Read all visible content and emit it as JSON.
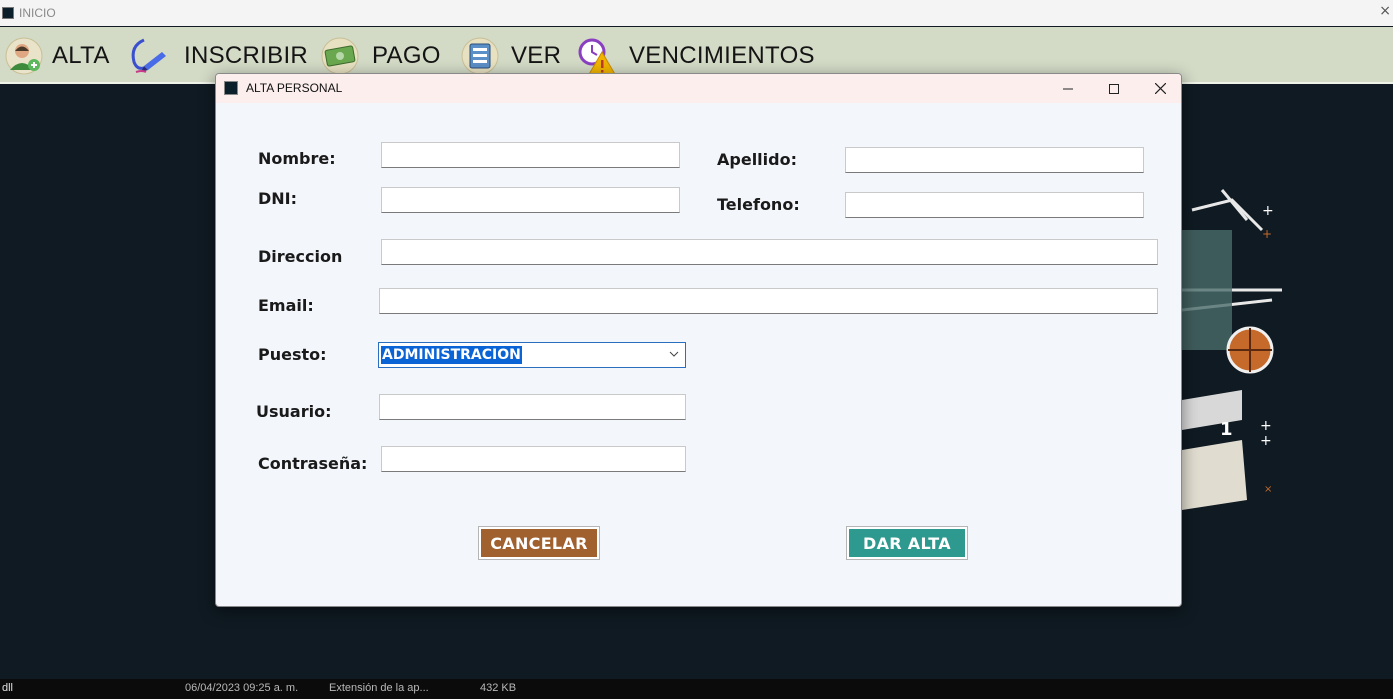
{
  "window": {
    "title": "INICIO",
    "close_glyph": "×"
  },
  "menu": {
    "items": [
      {
        "label": "ALTA",
        "icon": "user-add-icon"
      },
      {
        "label": "INSCRIBIR",
        "icon": "pen-icon"
      },
      {
        "label": "PAGO",
        "icon": "money-icon"
      },
      {
        "label": "VER",
        "icon": "list-icon"
      },
      {
        "label": "VENCIMIENTOS",
        "icon": "alarm-warning-icon"
      }
    ]
  },
  "dialog": {
    "title": "ALTA PERSONAL",
    "fields": {
      "nombre": {
        "label": "Nombre:",
        "value": ""
      },
      "apellido": {
        "label": "Apellido:",
        "value": ""
      },
      "dni": {
        "label": "DNI:",
        "value": ""
      },
      "telefono": {
        "label": "Telefono:",
        "value": ""
      },
      "direccion": {
        "label": "Direccion",
        "value": ""
      },
      "email": {
        "label": "Email:",
        "value": ""
      },
      "puesto": {
        "label": "Puesto:",
        "value": "ADMINISTRACION"
      },
      "usuario": {
        "label": "Usuario:",
        "value": ""
      },
      "contrasena": {
        "label": "Contraseña:",
        "value": ""
      }
    },
    "buttons": {
      "cancel": {
        "label": "CANCELAR",
        "color": "#a0612f"
      },
      "submit": {
        "label": "DAR ALTA",
        "color": "#2e9a8f"
      }
    }
  },
  "statusbar": {
    "ext": "dll",
    "date": "06/04/2023 09:25 a. m.",
    "type": "Extensión de la ap...",
    "size": "432 KB"
  }
}
